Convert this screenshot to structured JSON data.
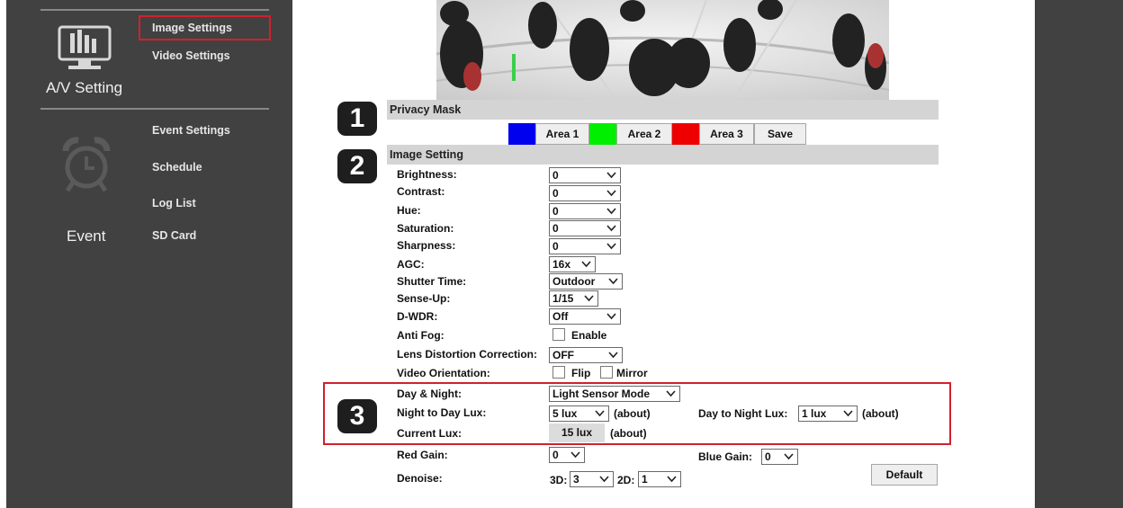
{
  "sidebar": {
    "av": {
      "section_label": "A/V Setting",
      "items": [
        {
          "label": "Image Settings",
          "selected": true
        },
        {
          "label": "Video Settings",
          "selected": false
        }
      ]
    },
    "event": {
      "section_label": "Event",
      "items": [
        {
          "label": "Event Settings"
        },
        {
          "label": "Schedule"
        },
        {
          "label": "Log List"
        },
        {
          "label": "SD Card"
        }
      ]
    }
  },
  "badges": [
    "1",
    "2",
    "3"
  ],
  "privacy": {
    "title": "Privacy Mask",
    "areas": [
      {
        "label": "Area 1",
        "color": "#0000ee"
      },
      {
        "label": "Area 2",
        "color": "#00ee00"
      },
      {
        "label": "Area 3",
        "color": "#ee0000"
      }
    ],
    "save_label": "Save"
  },
  "image_setting": {
    "title": "Image Setting",
    "fields": {
      "brightness": {
        "label": "Brightness:",
        "value": "0"
      },
      "contrast": {
        "label": "Contrast:",
        "value": "0"
      },
      "hue": {
        "label": "Hue:",
        "value": "0"
      },
      "saturation": {
        "label": "Saturation:",
        "value": "0"
      },
      "sharpness": {
        "label": "Sharpness:",
        "value": "0"
      },
      "agc": {
        "label": "AGC:",
        "value": "16x"
      },
      "shutter": {
        "label": "Shutter Time:",
        "value": "Outdoor"
      },
      "senseup": {
        "label": "Sense-Up:",
        "value": "1/15"
      },
      "dwdr": {
        "label": "D-WDR:",
        "value": "Off"
      },
      "lens": {
        "label": "Lens Distortion Correction:",
        "value": "OFF"
      }
    },
    "anti_fog": {
      "label": "Anti Fog:",
      "option": "Enable",
      "checked": false
    },
    "orientation": {
      "label": "Video Orientation:",
      "flip": "Flip",
      "mirror": "Mirror"
    },
    "day_night": {
      "label": "Day & Night:",
      "value": "Light Sensor Mode"
    },
    "night_to_day": {
      "label": "Night to Day Lux:",
      "value": "5 lux",
      "suffix": "(about)"
    },
    "day_to_night": {
      "label": "Day to Night Lux:",
      "value": "1 lux",
      "suffix": "(about)"
    },
    "current_lux": {
      "label": "Current Lux:",
      "value": "15 lux",
      "suffix": "(about)"
    },
    "red_gain": {
      "label": "Red Gain:",
      "value": "0"
    },
    "blue_gain": {
      "label": "Blue Gain:",
      "value": "0"
    },
    "denoise": {
      "label": "Denoise:",
      "d3_label": "3D:",
      "d3_value": "3",
      "d2_label": "2D:",
      "d2_value": "1"
    },
    "default_label": "Default"
  },
  "colors": {
    "sidebar_bg": "#414141",
    "highlight": "#d0212e",
    "header_bg": "#d4d4d4"
  }
}
